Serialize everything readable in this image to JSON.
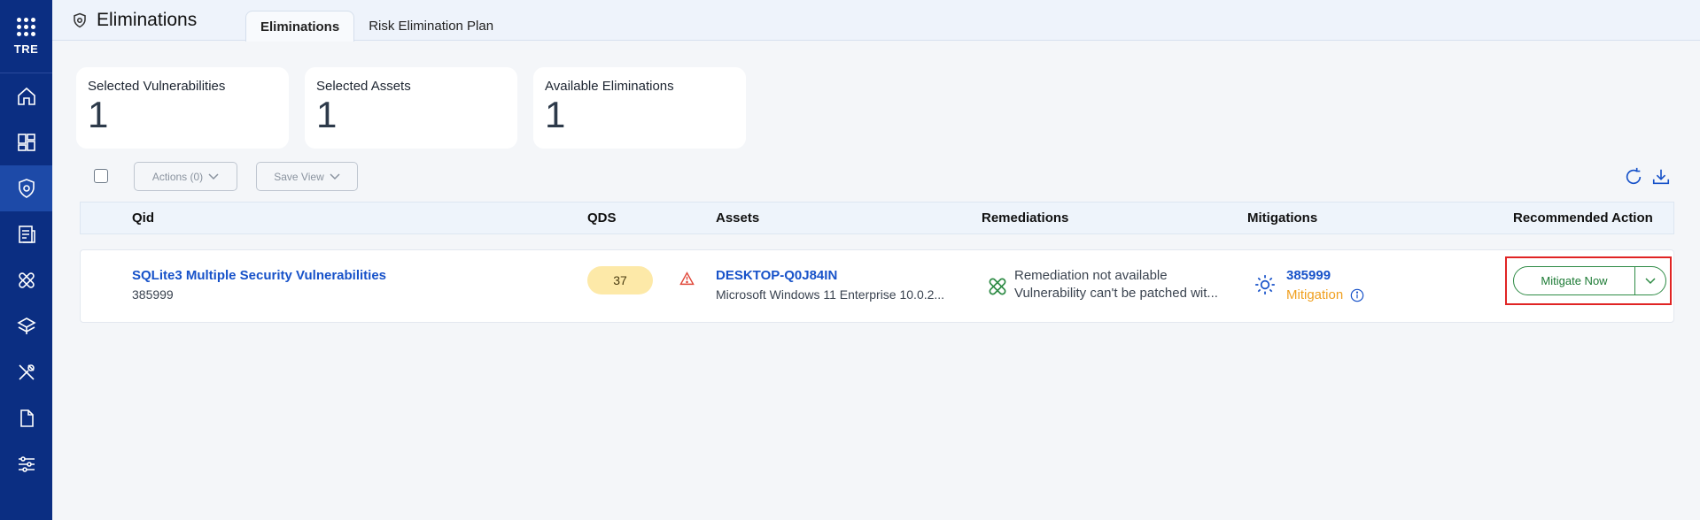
{
  "sidebar": {
    "brand": "TRE",
    "items": [
      {
        "icon": "home-icon"
      },
      {
        "icon": "dashboard-icon"
      },
      {
        "icon": "shield-gear-icon",
        "active": true
      },
      {
        "icon": "report-icon"
      },
      {
        "icon": "patch-icon"
      },
      {
        "icon": "layers-icon"
      },
      {
        "icon": "tools-icon"
      },
      {
        "icon": "document-icon"
      },
      {
        "icon": "sliders-icon"
      }
    ]
  },
  "header": {
    "title": "Eliminations",
    "tabs": [
      {
        "label": "Eliminations",
        "active": true
      },
      {
        "label": "Risk Elimination Plan",
        "active": false
      }
    ]
  },
  "stats": [
    {
      "label": "Selected Vulnerabilities",
      "value": "1"
    },
    {
      "label": "Selected Assets",
      "value": "1"
    },
    {
      "label": "Available Eliminations",
      "value": "1"
    }
  ],
  "toolbar": {
    "actions_label": "Actions (0)",
    "save_view_label": "Save View"
  },
  "table": {
    "columns": [
      "Qid",
      "QDS",
      "Assets",
      "Remediations",
      "Mitigations",
      "Recommended Action"
    ],
    "rows": [
      {
        "qid_title": "SQLite3 Multiple Security Vulnerabilities",
        "qid": "385999",
        "qds": "37",
        "asset_name": "DESKTOP-Q0J84IN",
        "asset_os": "Microsoft Windows 11 Enterprise 10.0.2...",
        "remediation_title": "Remediation not available",
        "remediation_detail": "Vulnerability can't be patched wit...",
        "mitigation_id": "385999",
        "mitigation_type": "Mitigation",
        "action_label": "Mitigate Now"
      }
    ]
  },
  "colors": {
    "sidebar": "#0b2e82",
    "link": "#1752c9",
    "qds_badge": "#fde9a8",
    "mitigation_orange": "#f0a020",
    "action_green": "#2e8b45",
    "highlight_red": "#e02424"
  }
}
